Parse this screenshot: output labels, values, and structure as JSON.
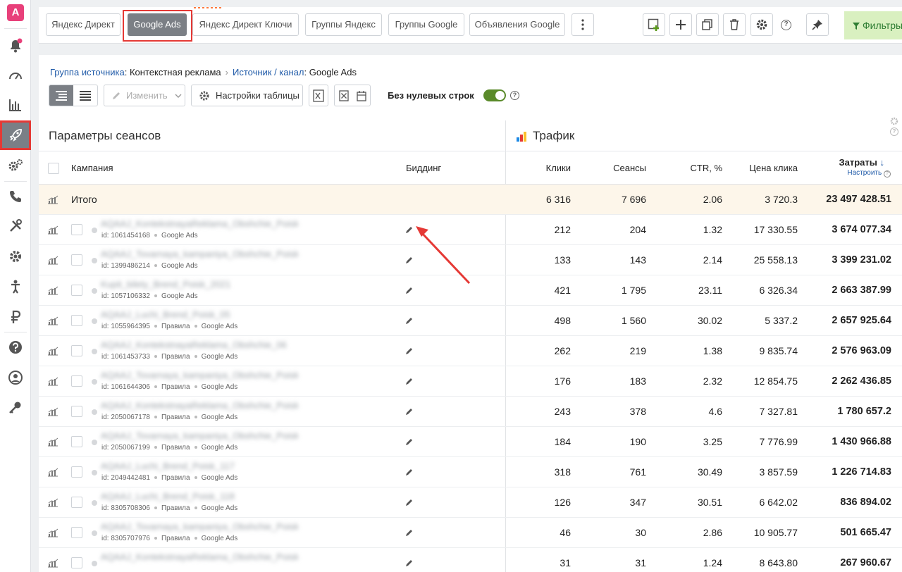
{
  "sidebar": {
    "logo": "A",
    "icons": [
      "bell-icon",
      "speedometer-icon",
      "bar-chart-icon",
      "rocket-icon",
      "gears-icon",
      "phone-icon",
      "tools-icon",
      "gear-icon",
      "person-icon",
      "ruble-icon",
      "help-icon",
      "user-icon",
      "key-icon"
    ],
    "active": "rocket-icon"
  },
  "toolbar": {
    "tabs": [
      "Яндекс Директ",
      "Google Ads",
      "Яндекс Директ Ключи",
      "Группы Яндекс",
      "Группы Google",
      "Объявления Google"
    ],
    "active_tab": "Google Ads",
    "filter_label": "Фильтры"
  },
  "breadcrumb": {
    "group_link": "Группа источника",
    "group_value": ": Контекстная реклама",
    "source_link": "Источник / канал",
    "source_value": ": Google Ads"
  },
  "table_toolbar": {
    "edit_label": "Изменить",
    "settings_label": "Настройки таблицы",
    "zero_rows_label": "Без нулевых строк",
    "zero_rows_on": true
  },
  "table": {
    "left_group": "Параметры сеансов",
    "right_group": "Трафик",
    "columns": {
      "campaign": "Кампания",
      "bidding": "Биддинг",
      "clicks": "Клики",
      "sessions": "Сеансы",
      "ctr": "CTR, %",
      "cpc": "Цена клика",
      "cost": "Затраты",
      "cost_sub": "Настроить"
    },
    "total": {
      "label": "Итого",
      "clicks": "6 316",
      "sessions": "7 696",
      "ctr": "2.06",
      "cpc": "3 720.3",
      "cost": "23 497 428.51"
    },
    "rows": [
      {
        "name": "AQAAJ_KontekstnayaReklama_Obshchie_Poisk_2022",
        "id": "id: 1061454168",
        "tags": [
          "Google Ads"
        ],
        "clicks": "212",
        "sessions": "204",
        "ctr": "1.32",
        "cpc": "17 330.55",
        "cost": "3 674 077.34"
      },
      {
        "name": "AQAAJ_Tovarnaya_kampaniya_Obshchie_Poisk_2022",
        "id": "id: 1399486214",
        "tags": [
          "Google Ads"
        ],
        "clicks": "133",
        "sessions": "143",
        "ctr": "2.14",
        "cpc": "25 558.13",
        "cost": "3 399 231.02"
      },
      {
        "name": "Kupit_bilety_Brend_Poisk_2021",
        "id": "id: 1057106332",
        "tags": [
          "Google Ads"
        ],
        "clicks": "421",
        "sessions": "1 795",
        "ctr": "23.11",
        "cpc": "6 326.34",
        "cost": "2 663 387.99"
      },
      {
        "name": "AQAAJ_Luchi_Brend_Poisk_05",
        "id": "id: 1055964395",
        "tags": [
          "Правила",
          "Google Ads"
        ],
        "clicks": "498",
        "sessions": "1 560",
        "ctr": "30.02",
        "cpc": "5 337.2",
        "cost": "2 657 925.64"
      },
      {
        "name": "AQAAJ_KontekstnayaReklama_Obshchie_06",
        "id": "id: 1061453733",
        "tags": [
          "Правила",
          "Google Ads"
        ],
        "clicks": "262",
        "sessions": "219",
        "ctr": "1.38",
        "cpc": "9 835.74",
        "cost": "2 576 963.09"
      },
      {
        "name": "AQAAJ_Tovarnaya_kampaniya_Obshchie_Poisk_04",
        "id": "id: 1061644306",
        "tags": [
          "Правила",
          "Google Ads"
        ],
        "clicks": "176",
        "sessions": "183",
        "ctr": "2.32",
        "cpc": "12 854.75",
        "cost": "2 262 436.85"
      },
      {
        "name": "AQAAJ_KontekstnayaReklama_Obshchie_Poisk_107",
        "id": "id: 2050067178",
        "tags": [
          "Правила",
          "Google Ads"
        ],
        "clicks": "243",
        "sessions": "378",
        "ctr": "4.6",
        "cpc": "7 327.81",
        "cost": "1 780 657.2"
      },
      {
        "name": "AQAAJ_Tovarnaya_kampaniya_Obshchie_Poisk_117",
        "id": "id: 2050067199",
        "tags": [
          "Правила",
          "Google Ads"
        ],
        "clicks": "184",
        "sessions": "190",
        "ctr": "3.25",
        "cpc": "7 776.99",
        "cost": "1 430 966.88"
      },
      {
        "name": "AQAAJ_Luchi_Brend_Poisk_117",
        "id": "id: 2049442481",
        "tags": [
          "Правила",
          "Google Ads"
        ],
        "clicks": "318",
        "sessions": "761",
        "ctr": "30.49",
        "cpc": "3 857.59",
        "cost": "1 226 714.83"
      },
      {
        "name": "AQAAJ_Luchi_Brend_Poisk_118",
        "id": "id: 8305708306",
        "tags": [
          "Правила",
          "Google Ads"
        ],
        "clicks": "126",
        "sessions": "347",
        "ctr": "30.51",
        "cpc": "6 642.02",
        "cost": "836 894.02"
      },
      {
        "name": "AQAAJ_Tovarnaya_kampaniya_Obshchie_Poisk_118",
        "id": "id: 8305707976",
        "tags": [
          "Правила",
          "Google Ads"
        ],
        "clicks": "46",
        "sessions": "30",
        "ctr": "2.86",
        "cpc": "10 905.77",
        "cost": "501 665.47"
      },
      {
        "name": "AQAAJ_KontekstnayaReklama_Obshchie_Poisk_119",
        "id": "",
        "tags": [],
        "clicks": "31",
        "sessions": "31",
        "ctr": "1.24",
        "cpc": "8 643.80",
        "cost": "267 960.67"
      }
    ]
  },
  "colors": {
    "accent_link": "#1f5aa8",
    "active_tab": "#7b7f85",
    "highlight": "#e53935",
    "total_row": "#fdf6ea",
    "switch_on": "#5a8a2a"
  }
}
